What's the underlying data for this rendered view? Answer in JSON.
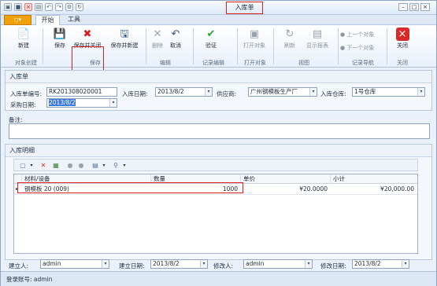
{
  "window": {
    "title": "入库单"
  },
  "tabs": {
    "file": "◻▾",
    "start": "开始",
    "tools": "工具"
  },
  "ribbon": {
    "new": "新建",
    "save": "保存",
    "save_close": "保存并关闭",
    "save_new": "保存并新建",
    "delete": "删除",
    "cancel": "取消",
    "verify": "验证",
    "open_object": "打开对象",
    "refresh": "刷新",
    "show_report": "显示报表",
    "prev_object": "上一个对象",
    "next_object": "下一个对象",
    "close": "关闭",
    "groups": [
      "对象创建",
      "保存",
      "编辑",
      "记录编辑",
      "打开对象",
      "视图",
      "记录导航",
      "关闭"
    ]
  },
  "form": {
    "section_title": "入库单",
    "code_label": "入库单编号:",
    "code_value": "RK201308020001",
    "date_label": "入库日期:",
    "date_value": "2013/8/2",
    "supplier_label": "供应商:",
    "supplier_value": "广州钢模板生产厂",
    "warehouse_label": "入库仓库:",
    "warehouse_value": "1号仓库",
    "purchase_date_label": "采购日期:",
    "purchase_date_value": "2013/8/2",
    "remark_label": "备注:"
  },
  "detail": {
    "section_title": "入库明细",
    "columns": [
      "材料/设备",
      "数量",
      "单价",
      "小计"
    ],
    "rows": [
      {
        "material": "钢模板 20 (009)",
        "qty": "1000",
        "price": "¥20.0000",
        "subtotal": "¥20,000.00"
      }
    ]
  },
  "footer": {
    "creator_label": "建立人:",
    "creator_value": "admin",
    "create_date_label": "建立日期:",
    "create_date_value": "2013/8/2",
    "modifier_label": "修改人:",
    "modifier_value": "admin",
    "modify_date_label": "修改日期:",
    "modify_date_value": "2013/8/2"
  },
  "status": {
    "login": "登录账号: admin"
  }
}
